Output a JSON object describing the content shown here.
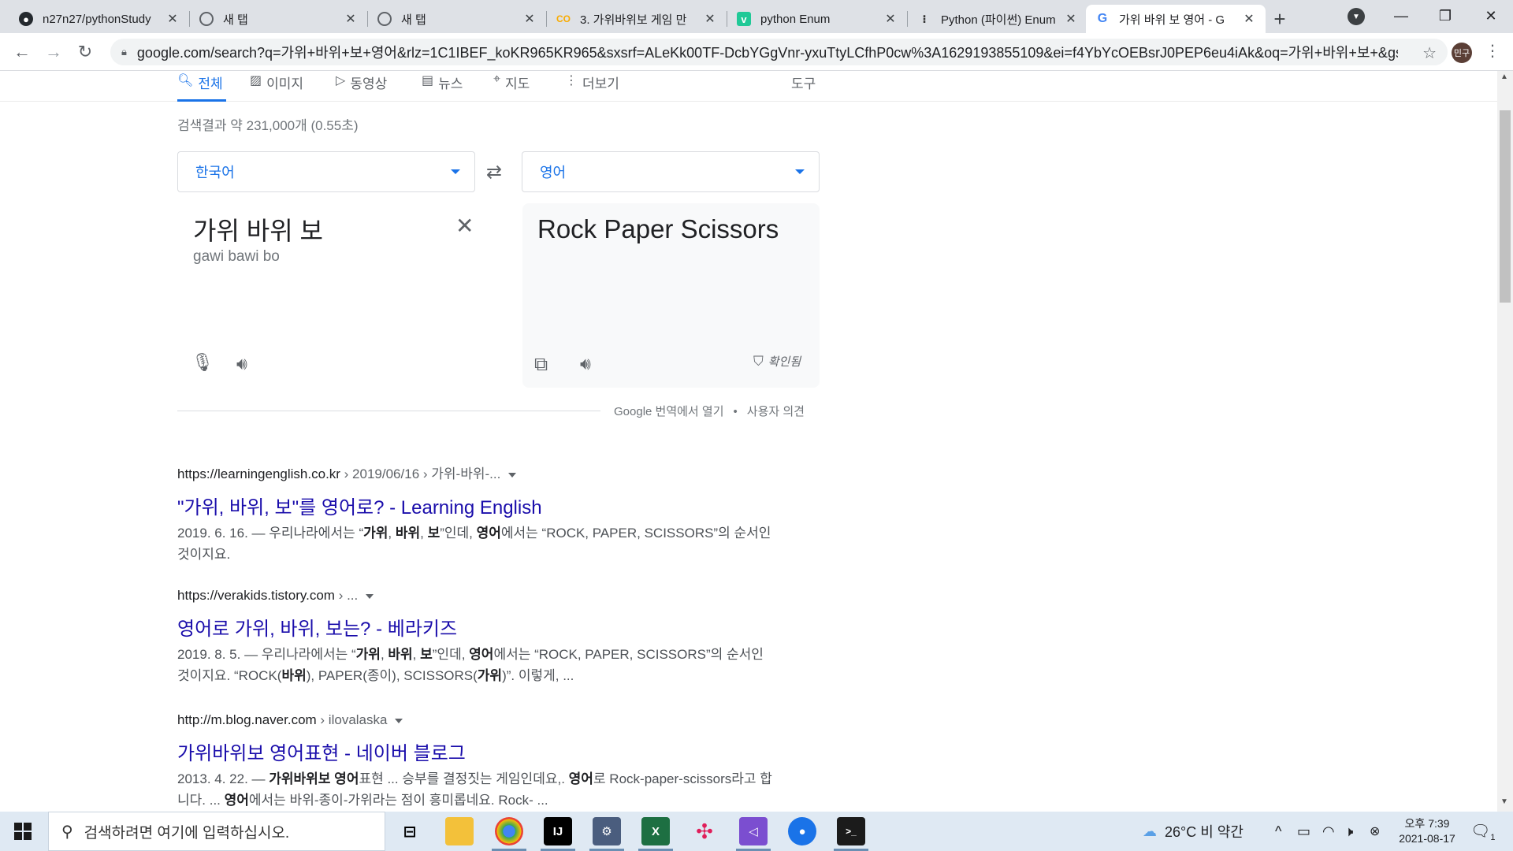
{
  "browser": {
    "tabs": [
      {
        "label": "n27n27/pythonStudy",
        "icon": "github-icon"
      },
      {
        "label": "새 탭",
        "icon": "chrome-icon"
      },
      {
        "label": "새 탭",
        "icon": "chrome-icon"
      },
      {
        "label": "3. 가위바위보 게임 만",
        "icon": "colab-icon"
      },
      {
        "label": "python Enum",
        "icon": "velog-icon"
      },
      {
        "label": "Python (파이썬) Enum",
        "icon": "tistory-icon"
      },
      {
        "label": "가위 바위 보 영어 - G",
        "icon": "google-icon"
      }
    ],
    "url": "google.com/search?q=가위+바위+보+영어&rlz=1C1IBEF_koKR965KR965&sxsrf=ALeKk00TF-DcbYGgVnr-yxuTtyLCfhP0cw%3A1629193855109&ei=f4YbYcOEBsrJ0PEP6eu4iAk&oq=가위+바위+보+&gs_l...",
    "profile_label": "민구"
  },
  "search_nav": {
    "tabs": [
      {
        "label": "전체",
        "icon": "search-icon",
        "active": true
      },
      {
        "label": "이미지",
        "icon": "image-icon"
      },
      {
        "label": "동영상",
        "icon": "video-icon"
      },
      {
        "label": "뉴스",
        "icon": "news-icon"
      },
      {
        "label": "지도",
        "icon": "map-pin-icon"
      },
      {
        "label": "더보기",
        "icon": "more-vert-icon"
      }
    ],
    "tools_label": "도구"
  },
  "stats": "검색결과 약 231,000개 (0.55초)",
  "translate": {
    "source_lang": "한국어",
    "target_lang": "영어",
    "source_text": "가위 바위 보",
    "source_romanization": "gawi bawi bo",
    "target_text": "Rock Paper Scissors",
    "verified_label": "확인됨",
    "open_in_translate": "Google 번역에서 열기",
    "feedback": "사용자 의견"
  },
  "results": [
    {
      "site": "https://learningenglish.co.kr",
      "path": " › 2019/06/16 › 가위-바위-...",
      "title": "\"가위, 바위, 보\"를 영어로? - Learning English",
      "snippet_html": "2019. 6. 16. — 우리나라에서는 “<b>가위</b>, <b>바위</b>, <b>보</b>”인데, <b>영어</b>에서는 “ROCK, PAPER, SCISSORS”의 순서인 것이지요."
    },
    {
      "site": "https://verakids.tistory.com",
      "path": " › ...",
      "title": "영어로 가위, 바위, 보는? - 베라키즈",
      "snippet_html": "2019. 8. 5. — 우리나라에서는 “<b>가위</b>, <b>바위</b>, <b>보</b>”인데, <b>영어</b>에서는 “ROCK, PAPER, SCISSORS”의 순서인 것이지요. “ROCK(<b>바위</b>), PAPER(종이), SCISSORS(<b>가위</b>)”. 이렇게, ..."
    },
    {
      "site": "http://m.blog.naver.com",
      "path": " › ilovalaska",
      "title": "가위바위보 영어표현 - 네이버 블로그",
      "snippet_html": "2013. 4. 22. — <b>가위바위보 영어</b>표현 ... 승부를 결정짓는 게임인데요,. <b>영어</b>로 Rock-paper-scissors라고 합니다. ... <b>영어</b>에서는 바위-종이-가위라는 점이 흥미롭네요. Rock- ..."
    }
  ],
  "taskbar": {
    "search_placeholder": "검색하려면 여기에 입력하십시오.",
    "apps": [
      "task-view-icon",
      "file-explorer-icon",
      "chrome-icon",
      "intellij-icon",
      "tool-icon",
      "excel-icon",
      "slack-icon",
      "visual-studio-icon",
      "maps-icon",
      "terminal-icon"
    ],
    "weather": "26°C  비 약간",
    "clock_time": "오후 7:39",
    "clock_date": "2021-08-17",
    "notification_count": "1"
  },
  "colors": {
    "accent": "#1a73e8",
    "link": "#1a0dab",
    "tabstrip": "#dee1e6",
    "taskbar": "#dfe9f3"
  }
}
